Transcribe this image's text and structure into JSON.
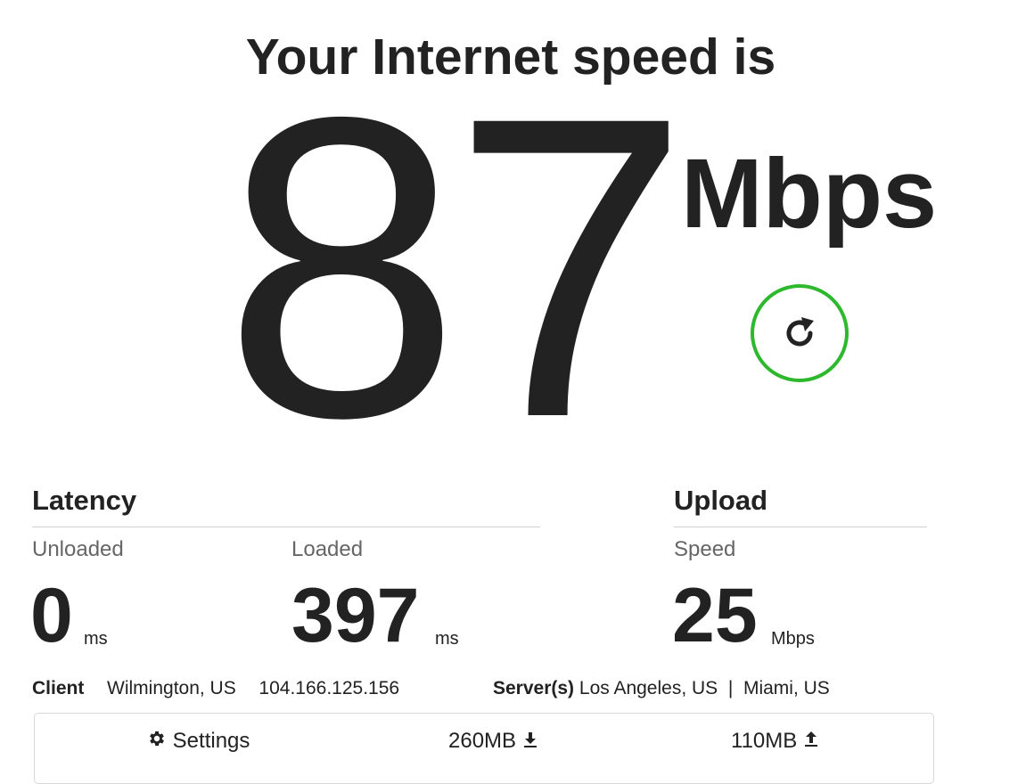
{
  "header": {
    "title": "Your Internet speed is"
  },
  "download": {
    "value": "87",
    "unit": "Mbps"
  },
  "latency": {
    "title": "Latency",
    "unloaded": {
      "label": "Unloaded",
      "value": "0",
      "unit": "ms"
    },
    "loaded": {
      "label": "Loaded",
      "value": "397",
      "unit": "ms"
    }
  },
  "upload": {
    "title": "Upload",
    "speed": {
      "label": "Speed",
      "value": "25",
      "unit": "Mbps"
    }
  },
  "client": {
    "label": "Client",
    "location": "Wilmington, US",
    "ip": "104.166.125.156"
  },
  "servers": {
    "label": "Server(s)",
    "list": "Los Angeles, US  |  Miami, US"
  },
  "footer": {
    "settings_label": "Settings",
    "download_data": "260MB",
    "upload_data": "110MB"
  },
  "icons": {
    "refresh": "refresh-icon",
    "settings": "gear-icon",
    "download": "download-arrow-icon",
    "upload": "upload-arrow-icon"
  },
  "colors": {
    "accent": "#2eb82e",
    "text": "#222222",
    "muted": "#666666"
  }
}
